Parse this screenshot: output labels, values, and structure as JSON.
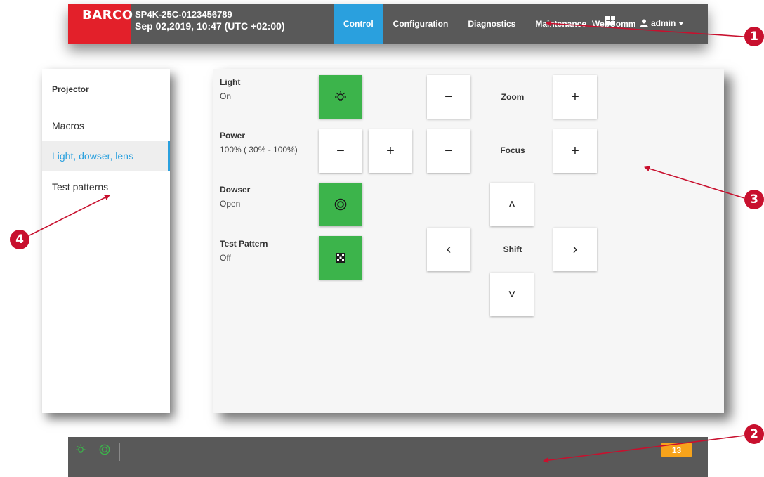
{
  "header": {
    "logo": "BARCO",
    "device_name": "SP4K-25C-0123456789",
    "datetime": "Sep 02,2019, 10:47 (UTC +02:00)",
    "tabs": [
      {
        "label": "Control",
        "active": true
      },
      {
        "label": "Configuration",
        "active": false
      },
      {
        "label": "Diagnostics",
        "active": false
      },
      {
        "label": "Maintenance",
        "active": false
      },
      {
        "label": "WebComm",
        "active": false
      }
    ],
    "user": "admin"
  },
  "sidebar": {
    "title": "Projector",
    "items": [
      {
        "label": "Macros",
        "active": false
      },
      {
        "label": "Light, dowser, lens",
        "active": true
      },
      {
        "label": "Test patterns",
        "active": false
      }
    ]
  },
  "controls": {
    "light": {
      "label": "Light",
      "value": "On"
    },
    "power": {
      "label": "Power",
      "value": "100% ( 30% - 100%)"
    },
    "dowser": {
      "label": "Dowser",
      "value": "Open"
    },
    "test_pattern": {
      "label": "Test Pattern",
      "value": "Off"
    },
    "zoom_label": "Zoom",
    "focus_label": "Focus",
    "shift_label": "Shift",
    "minus": "−",
    "plus": "+",
    "up": "˄",
    "down": "˅",
    "left": "‹",
    "right": "›"
  },
  "statusbar": {
    "notification_count": "13"
  },
  "callouts": [
    "1",
    "2",
    "3",
    "4"
  ],
  "colors": {
    "accent": "#2aa0de",
    "brand_red": "#e3202a",
    "active_green": "#3cb44b",
    "bar_gray": "#595959",
    "badge_orange": "#f7a31b",
    "callout_red": "#c8102e"
  }
}
